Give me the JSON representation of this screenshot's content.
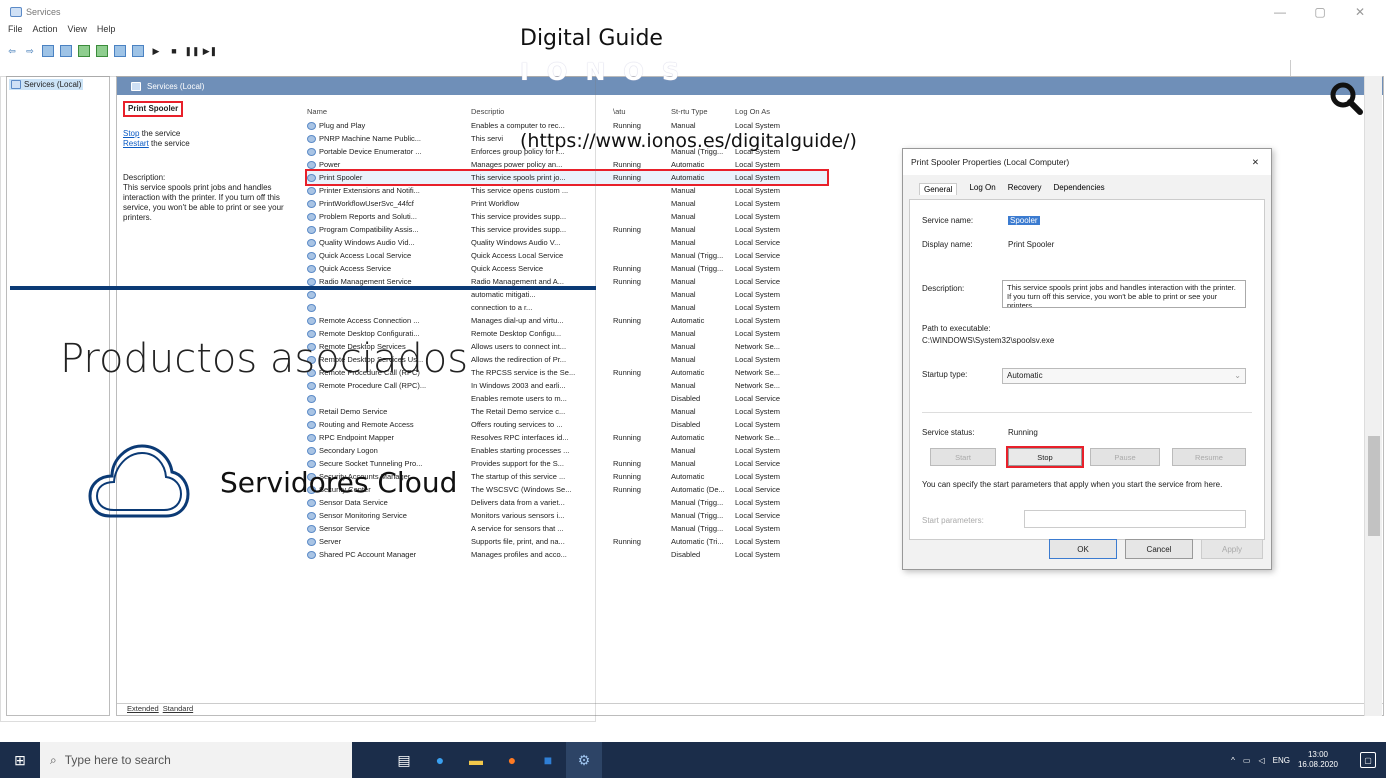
{
  "window": {
    "title": "Services",
    "controls": [
      "—",
      "▢",
      "✕"
    ]
  },
  "menu": [
    "File",
    "Action",
    "View",
    "Help"
  ],
  "tree": {
    "item": "Services (Local)"
  },
  "panel": {
    "header": "Services (Local)"
  },
  "left": {
    "selected_service": "Print Spooler",
    "stop_link": "Stop",
    "stop_rest": " the service",
    "restart_link": "Restart",
    "restart_rest": " the service",
    "description_label": "Description:",
    "description": "This service spools print jobs and handles interaction with the printer. If you turn off this service, you won't be able to print or see your printers."
  },
  "columns": {
    "name": "Name",
    "desc": "Descriptio",
    "status": "\\atu",
    "type": "St-rtu Type",
    "logon": "Log On As"
  },
  "rows": [
    {
      "name": "Plug and Play",
      "desc": "Enables a computer to rec...",
      "status": "Running",
      "type": "Manual",
      "logon": "Local System"
    },
    {
      "name": "PNRP Machine Name Public...",
      "desc": "This servi",
      "status": "",
      "type": "",
      "logon": ""
    },
    {
      "name": "Portable Device Enumerator ...",
      "desc": "Enforces group policy for r...",
      "status": "",
      "type": "Manual (Trigg...",
      "logon": "Local System"
    },
    {
      "name": "Power",
      "desc": "Manages power policy an...",
      "status": "Running",
      "type": "Automatic",
      "logon": "Local System"
    },
    {
      "name": "Print Spooler",
      "desc": "This service spools print jo...",
      "status": "Running",
      "type": "Automatic",
      "logon": "Local System",
      "selected": true
    },
    {
      "name": "Printer Extensions and Notifi...",
      "desc": "This service opens custom ...",
      "status": "",
      "type": "Manual",
      "logon": "Local System"
    },
    {
      "name": "PrintWorkflowUserSvc_44fcf",
      "desc": "Print Workflow",
      "status": "",
      "type": "Manual",
      "logon": "Local System"
    },
    {
      "name": "Problem Reports and Soluti...",
      "desc": "This service provides supp...",
      "status": "",
      "type": "Manual",
      "logon": "Local System"
    },
    {
      "name": "Program Compatibility Assis...",
      "desc": "This service provides supp...",
      "status": "Running",
      "type": "Manual",
      "logon": "Local System"
    },
    {
      "name": "Quality Windows Audio Vid...",
      "desc": "Quality Windows Audio V...",
      "status": "",
      "type": "Manual",
      "logon": "Local Service"
    },
    {
      "name": "Quick Access Local Service",
      "desc": "Quick Access Local Service",
      "status": "",
      "type": "Manual (Trigg...",
      "logon": "Local Service"
    },
    {
      "name": "Quick Access Service",
      "desc": "Quick Access Service",
      "status": "Running",
      "type": "Manual (Trigg...",
      "logon": "Local System"
    },
    {
      "name": "Radio Management Service",
      "desc": "Radio Management and A...",
      "status": "Running",
      "type": "Manual",
      "logon": "Local Service"
    },
    {
      "name": "",
      "desc": "automatic mitigati...",
      "status": "",
      "type": "Manual",
      "logon": "Local System"
    },
    {
      "name": "",
      "desc": "connection to a r...",
      "status": "",
      "type": "Manual",
      "logon": "Local System"
    },
    {
      "name": "Remote Access Connection ...",
      "desc": "Manages dial-up and virtu...",
      "status": "Running",
      "type": "Automatic",
      "logon": "Local System"
    },
    {
      "name": "Remote Desktop Configurati...",
      "desc": "Remote Desktop Configu...",
      "status": "",
      "type": "Manual",
      "logon": "Local System"
    },
    {
      "name": "Remote Desktop Services",
      "desc": "Allows users to connect int...",
      "status": "",
      "type": "Manual",
      "logon": "Network Se..."
    },
    {
      "name": "Remote Desktop Services Us...",
      "desc": "Allows the redirection of Pr...",
      "status": "",
      "type": "Manual",
      "logon": "Local System"
    },
    {
      "name": "Remote Procedure Call (RPC)",
      "desc": "The RPCSS service is the Se...",
      "status": "Running",
      "type": "Automatic",
      "logon": "Network Se..."
    },
    {
      "name": "Remote Procedure Call (RPC)...",
      "desc": "In Windows 2003 and earli...",
      "status": "",
      "type": "Manual",
      "logon": "Network Se..."
    },
    {
      "name": "",
      "desc": "Enables remote users to m...",
      "status": "",
      "type": "Disabled",
      "logon": "Local Service"
    },
    {
      "name": "Retail Demo Service",
      "desc": "The Retail Demo service c...",
      "status": "",
      "type": "Manual",
      "logon": "Local System"
    },
    {
      "name": "Routing and Remote Access",
      "desc": "Offers routing services to ...",
      "status": "",
      "type": "Disabled",
      "logon": "Local System"
    },
    {
      "name": "RPC Endpoint Mapper",
      "desc": "Resolves RPC interfaces id...",
      "status": "Running",
      "type": "Automatic",
      "logon": "Network Se..."
    },
    {
      "name": "Secondary Logon",
      "desc": "Enables starting processes ...",
      "status": "",
      "type": "Manual",
      "logon": "Local System"
    },
    {
      "name": "Secure Socket Tunneling Pro...",
      "desc": "Provides support for the S...",
      "status": "Running",
      "type": "Manual",
      "logon": "Local Service"
    },
    {
      "name": "Security Accounts Manager",
      "desc": "The startup of this service ...",
      "status": "Running",
      "type": "Automatic",
      "logon": "Local System"
    },
    {
      "name": "Security Center",
      "desc": "The WSCSVC (Windows Se...",
      "status": "Running",
      "type": "Automatic (De...",
      "logon": "Local Service"
    },
    {
      "name": "Sensor Data Service",
      "desc": "Delivers data from a variet...",
      "status": "",
      "type": "Manual (Trigg...",
      "logon": "Local System"
    },
    {
      "name": "Sensor Monitoring Service",
      "desc": "Monitors various sensors i...",
      "status": "",
      "type": "Manual (Trigg...",
      "logon": "Local Service"
    },
    {
      "name": "Sensor Service",
      "desc": "A service for sensors that ...",
      "status": "",
      "type": "Manual (Trigg...",
      "logon": "Local System"
    },
    {
      "name": "Server",
      "desc": "Supports file, print, and na...",
      "status": "Running",
      "type": "Automatic (Tri...",
      "logon": "Local System"
    },
    {
      "name": "Shared PC Account Manager",
      "desc": "Manages profiles and acco...",
      "status": "",
      "type": "Disabled",
      "logon": "Local System"
    }
  ],
  "bottom_tabs": [
    "Extended",
    "Standard"
  ],
  "dialog": {
    "title": "Print Spooler Properties (Local Computer)",
    "close": "✕",
    "tabs": [
      "General",
      "Log On",
      "Recovery",
      "Dependencies"
    ],
    "service_name_label": "Service name:",
    "service_name": "Spooler",
    "display_name_label": "Display name:",
    "display_name": "Print Spooler",
    "description_label": "Description:",
    "description": "This service spools print jobs and handles interaction with the printer. If you turn off this service, you won't be able to print or see your printers.",
    "path_label": "Path to executable:",
    "path": "C:\\WINDOWS\\System32\\spoolsv.exe",
    "startup_label": "Startup type:",
    "startup_value": "Automatic",
    "status_label": "Service status:",
    "status_value": "Running",
    "btn_start": "Start",
    "btn_stop": "Stop",
    "btn_pause": "Pause",
    "btn_resume": "Resume",
    "hint": "You can specify the start parameters that apply when you start the service from here.",
    "params_label": "Start parameters:",
    "ok": "OK",
    "cancel": "Cancel",
    "apply": "Apply"
  },
  "overlay": {
    "title": "Digital Guide",
    "brand": "IONOS",
    "url": "(https://www.ionos.es/digitalguide/)",
    "products": "Productos asociados",
    "cloud": "Servidores Cloud",
    "accent": "#0b3a75"
  },
  "taskbar": {
    "search_placeholder": "Type here to search",
    "lang": "ENG",
    "time": "13:00",
    "date": "16.08.2020"
  }
}
